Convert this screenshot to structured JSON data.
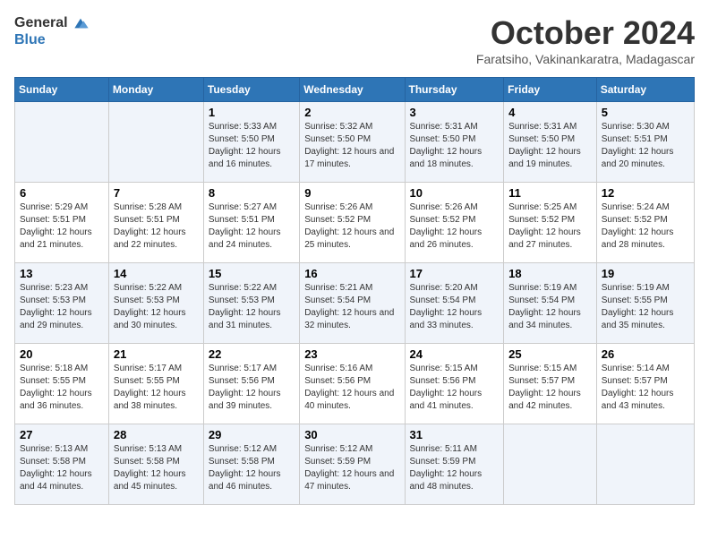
{
  "header": {
    "logo_line1": "General",
    "logo_line2": "Blue",
    "month": "October 2024",
    "location": "Faratsiho, Vakinankaratra, Madagascar"
  },
  "weekdays": [
    "Sunday",
    "Monday",
    "Tuesday",
    "Wednesday",
    "Thursday",
    "Friday",
    "Saturday"
  ],
  "weeks": [
    [
      {
        "day": null
      },
      {
        "day": null
      },
      {
        "day": "1",
        "sunrise": "5:33 AM",
        "sunset": "5:50 PM",
        "daylight": "12 hours and 16 minutes."
      },
      {
        "day": "2",
        "sunrise": "5:32 AM",
        "sunset": "5:50 PM",
        "daylight": "12 hours and 17 minutes."
      },
      {
        "day": "3",
        "sunrise": "5:31 AM",
        "sunset": "5:50 PM",
        "daylight": "12 hours and 18 minutes."
      },
      {
        "day": "4",
        "sunrise": "5:31 AM",
        "sunset": "5:50 PM",
        "daylight": "12 hours and 19 minutes."
      },
      {
        "day": "5",
        "sunrise": "5:30 AM",
        "sunset": "5:51 PM",
        "daylight": "12 hours and 20 minutes."
      }
    ],
    [
      {
        "day": "6",
        "sunrise": "5:29 AM",
        "sunset": "5:51 PM",
        "daylight": "12 hours and 21 minutes."
      },
      {
        "day": "7",
        "sunrise": "5:28 AM",
        "sunset": "5:51 PM",
        "daylight": "12 hours and 22 minutes."
      },
      {
        "day": "8",
        "sunrise": "5:27 AM",
        "sunset": "5:51 PM",
        "daylight": "12 hours and 24 minutes."
      },
      {
        "day": "9",
        "sunrise": "5:26 AM",
        "sunset": "5:52 PM",
        "daylight": "12 hours and 25 minutes."
      },
      {
        "day": "10",
        "sunrise": "5:26 AM",
        "sunset": "5:52 PM",
        "daylight": "12 hours and 26 minutes."
      },
      {
        "day": "11",
        "sunrise": "5:25 AM",
        "sunset": "5:52 PM",
        "daylight": "12 hours and 27 minutes."
      },
      {
        "day": "12",
        "sunrise": "5:24 AM",
        "sunset": "5:52 PM",
        "daylight": "12 hours and 28 minutes."
      }
    ],
    [
      {
        "day": "13",
        "sunrise": "5:23 AM",
        "sunset": "5:53 PM",
        "daylight": "12 hours and 29 minutes."
      },
      {
        "day": "14",
        "sunrise": "5:22 AM",
        "sunset": "5:53 PM",
        "daylight": "12 hours and 30 minutes."
      },
      {
        "day": "15",
        "sunrise": "5:22 AM",
        "sunset": "5:53 PM",
        "daylight": "12 hours and 31 minutes."
      },
      {
        "day": "16",
        "sunrise": "5:21 AM",
        "sunset": "5:54 PM",
        "daylight": "12 hours and 32 minutes."
      },
      {
        "day": "17",
        "sunrise": "5:20 AM",
        "sunset": "5:54 PM",
        "daylight": "12 hours and 33 minutes."
      },
      {
        "day": "18",
        "sunrise": "5:19 AM",
        "sunset": "5:54 PM",
        "daylight": "12 hours and 34 minutes."
      },
      {
        "day": "19",
        "sunrise": "5:19 AM",
        "sunset": "5:55 PM",
        "daylight": "12 hours and 35 minutes."
      }
    ],
    [
      {
        "day": "20",
        "sunrise": "5:18 AM",
        "sunset": "5:55 PM",
        "daylight": "12 hours and 36 minutes."
      },
      {
        "day": "21",
        "sunrise": "5:17 AM",
        "sunset": "5:55 PM",
        "daylight": "12 hours and 38 minutes."
      },
      {
        "day": "22",
        "sunrise": "5:17 AM",
        "sunset": "5:56 PM",
        "daylight": "12 hours and 39 minutes."
      },
      {
        "day": "23",
        "sunrise": "5:16 AM",
        "sunset": "5:56 PM",
        "daylight": "12 hours and 40 minutes."
      },
      {
        "day": "24",
        "sunrise": "5:15 AM",
        "sunset": "5:56 PM",
        "daylight": "12 hours and 41 minutes."
      },
      {
        "day": "25",
        "sunrise": "5:15 AM",
        "sunset": "5:57 PM",
        "daylight": "12 hours and 42 minutes."
      },
      {
        "day": "26",
        "sunrise": "5:14 AM",
        "sunset": "5:57 PM",
        "daylight": "12 hours and 43 minutes."
      }
    ],
    [
      {
        "day": "27",
        "sunrise": "5:13 AM",
        "sunset": "5:58 PM",
        "daylight": "12 hours and 44 minutes."
      },
      {
        "day": "28",
        "sunrise": "5:13 AM",
        "sunset": "5:58 PM",
        "daylight": "12 hours and 45 minutes."
      },
      {
        "day": "29",
        "sunrise": "5:12 AM",
        "sunset": "5:58 PM",
        "daylight": "12 hours and 46 minutes."
      },
      {
        "day": "30",
        "sunrise": "5:12 AM",
        "sunset": "5:59 PM",
        "daylight": "12 hours and 47 minutes."
      },
      {
        "day": "31",
        "sunrise": "5:11 AM",
        "sunset": "5:59 PM",
        "daylight": "12 hours and 48 minutes."
      },
      {
        "day": null
      },
      {
        "day": null
      }
    ]
  ],
  "labels": {
    "sunrise_prefix": "Sunrise: ",
    "sunset_prefix": "Sunset: ",
    "daylight_prefix": "Daylight: "
  }
}
